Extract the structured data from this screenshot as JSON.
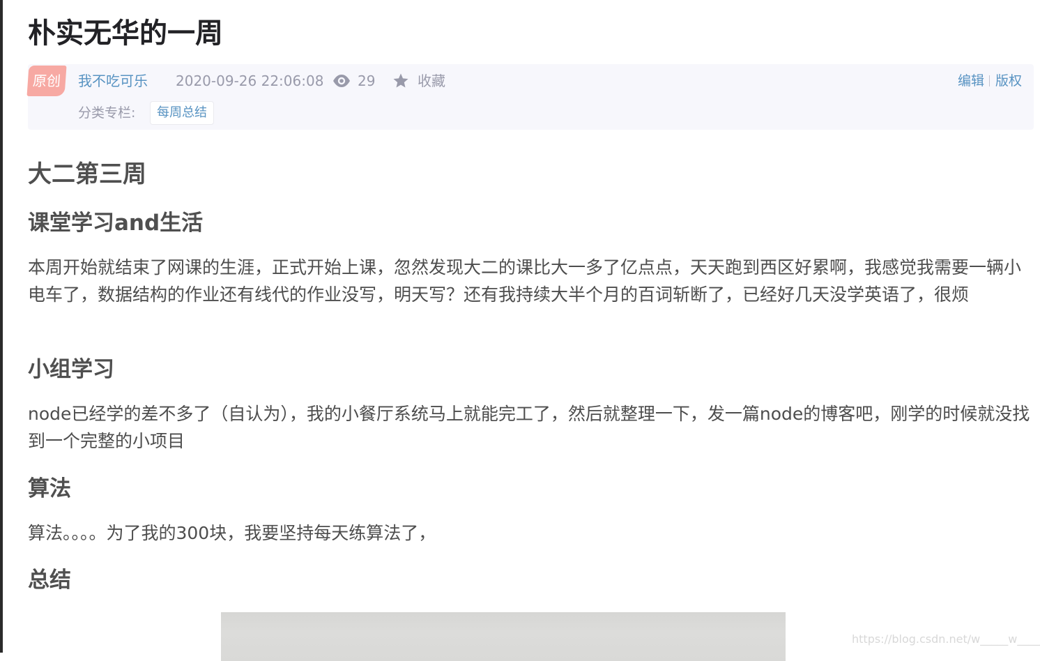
{
  "article": {
    "title": "朴实无华的一周",
    "meta": {
      "badge": "原创",
      "author": "我不吃可乐",
      "date": "2020-09-26 22:06:08",
      "views": "29",
      "collect_label": "收藏",
      "edit_label": "编辑",
      "copyright_label": "版权",
      "category_label": "分类专栏:",
      "category_tag": "每周总结"
    },
    "heading_main": "大二第三周",
    "sections": [
      {
        "heading": "课堂学习and生活",
        "text": "本周开始就结束了网课的生涯，正式开始上课，忽然发现大二的课比大一多了亿点点，天天跑到西区好累啊，我感觉我需要一辆小电车了，数据结构的作业还有线代的作业没写，明天写？还有我持续大半个月的百词斩断了，已经好几天没学英语了，很烦"
      },
      {
        "heading": "小组学习",
        "text": "node已经学的差不多了（自认为），我的小餐厅系统马上就能完工了，然后就整理一下，发一篇node的博客吧，刚学的时候就没找到一个完整的小项目"
      },
      {
        "heading": "算法",
        "text": "算法。。。。为了我的300块，我要坚持每天练算法了，"
      },
      {
        "heading": "总结",
        "text": ""
      }
    ],
    "watermark": "https://blog.csdn.net/w_____w_____"
  },
  "icons": {
    "views": "eye-icon",
    "collect": "star-icon"
  },
  "colors": {
    "link": "#5893c2",
    "muted": "#999aaa",
    "badge": "#f7a9a3",
    "meta_bg": "#f7f7fc"
  }
}
